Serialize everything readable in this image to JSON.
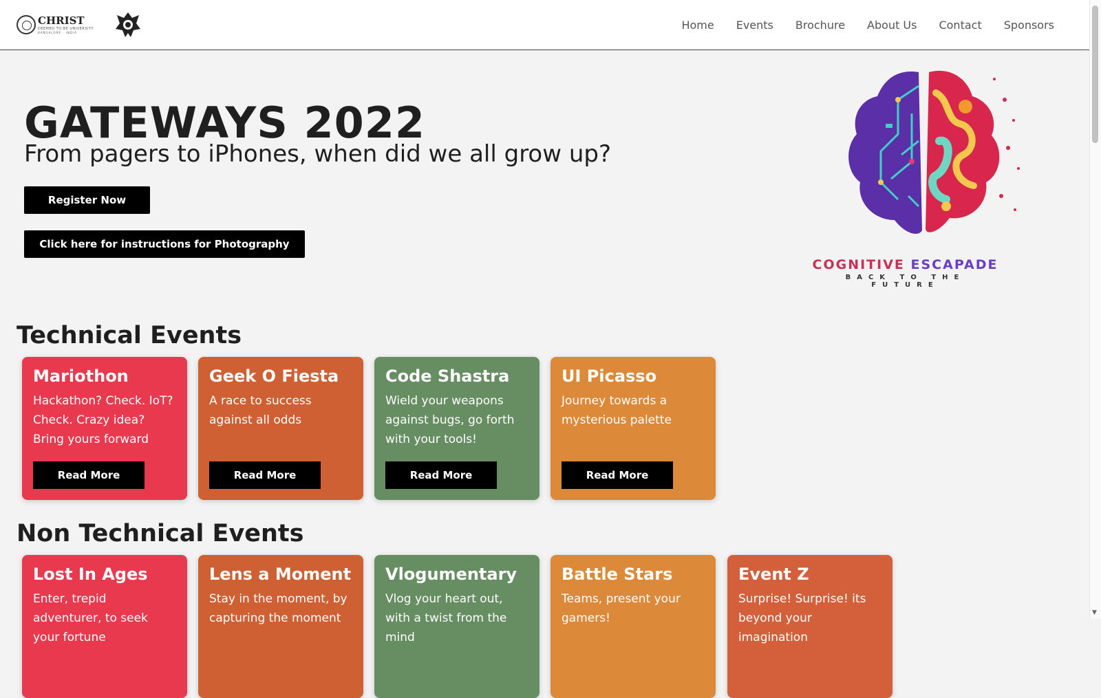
{
  "nav": {
    "logo_name": "CHRIST",
    "logo_sub": "DEEMED TO BE UNIVERSITY",
    "logo_sub2": "BANGALORE · INDIA",
    "links": [
      "Home",
      "Events",
      "Brochure",
      "About Us",
      "Contact",
      "Sponsors"
    ]
  },
  "hero": {
    "title": "GATEWAYS 2022",
    "subtitle": "From pagers to iPhones, when did we all grow up?",
    "register_label": "Register Now",
    "photo_label": "Click here for instructions for Photography",
    "brain_title_1": "COGNITIVE",
    "brain_title_2": "ESCAPADE",
    "brain_tagline": "BACK TO THE FUTURE"
  },
  "technical": {
    "heading": "Technical Events",
    "events": [
      {
        "name": "Mariothon",
        "desc": "Hackathon? Check. IoT? Check. Crazy idea? Bring yours forward",
        "button": "Read More",
        "color": "#e8394f"
      },
      {
        "name": "Geek O Fiesta",
        "desc": "A race to success against all odds",
        "button": "Read More",
        "color": "#cf6033"
      },
      {
        "name": "Code Shastra",
        "desc": "Wield your weapons against bugs, go forth with your tools!",
        "button": "Read More",
        "color": "#678e63"
      },
      {
        "name": "UI Picasso",
        "desc": "Journey towards a mysterious palette",
        "button": "Read More",
        "color": "#dc8a3a"
      }
    ]
  },
  "non_technical": {
    "heading": "Non Technical Events",
    "events": [
      {
        "name": "Lost In Ages",
        "desc": "Enter, trepid adventurer, to seek your fortune",
        "color": "#e8394f"
      },
      {
        "name": "Lens a Moment",
        "desc": "Stay in the moment, by capturing the moment",
        "color": "#cf6033"
      },
      {
        "name": "Vlogumentary",
        "desc": "Vlog your heart out, with a twist from the mind",
        "color": "#678e63"
      },
      {
        "name": "Battle Stars",
        "desc": "Teams, present your gamers!",
        "color": "#dc8a3a"
      },
      {
        "name": "Event Z",
        "desc": "Surprise! Surprise! its beyond your imagination",
        "color": "#d3603a"
      }
    ]
  }
}
